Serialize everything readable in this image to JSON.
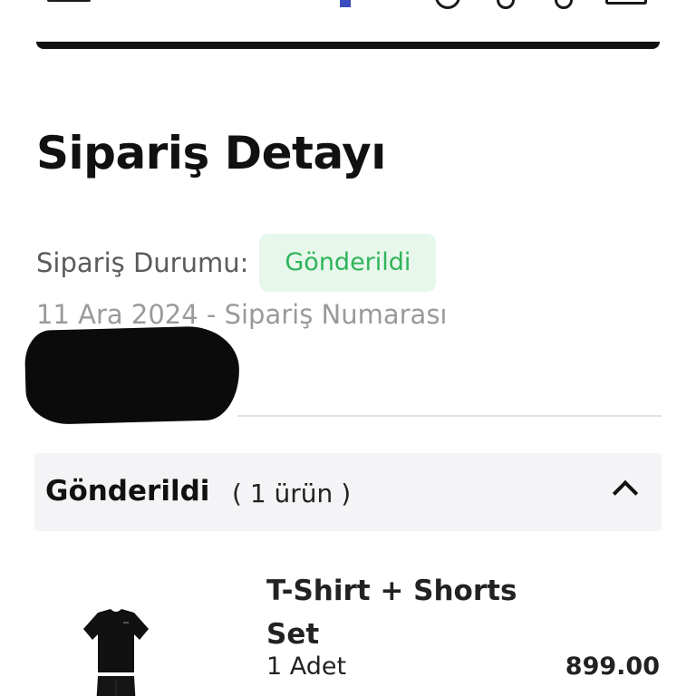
{
  "header": {
    "icons": [
      "menu-icon",
      "search-icon",
      "heart-icon",
      "user-icon",
      "cart-icon"
    ],
    "brand_color": "#3b4cc0"
  },
  "order": {
    "title": "Sipariş Detayı",
    "status_label": "Sipariş Durumu:",
    "status_value": "Gönderildi",
    "status_color": "#2fb45a",
    "status_bg": "#e8f7ec",
    "meta": "11 Ara 2024 - Sipariş Numarası"
  },
  "shipment": {
    "status": "Gönderildi",
    "item_count": "( 1 ürün )",
    "expanded": true
  },
  "items": [
    {
      "name": "T-Shirt + Shorts Set",
      "quantity": "1 Adet",
      "price": "899.00"
    }
  ]
}
